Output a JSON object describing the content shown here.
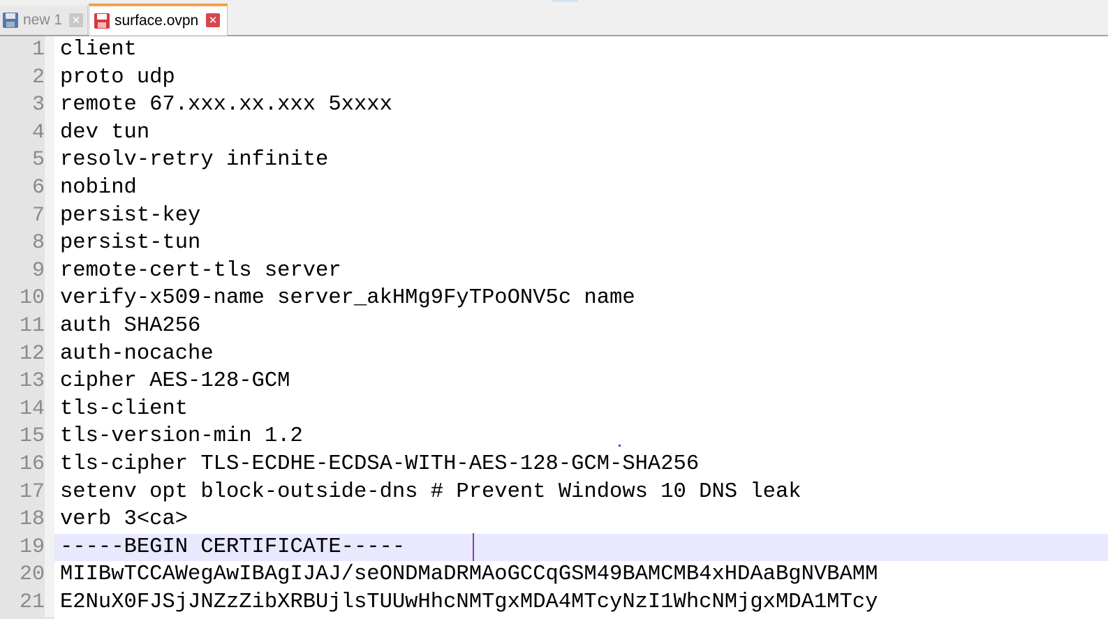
{
  "tabs": [
    {
      "label": "new 1",
      "active": false,
      "icon": "disk-icon",
      "icon_color": "#5577aa"
    },
    {
      "label": "surface.ovpn",
      "active": true,
      "icon": "disk-icon",
      "icon_color": "#d9363e"
    }
  ],
  "editor": {
    "current_line": 19,
    "lines": [
      {
        "num": "1",
        "text": "client"
      },
      {
        "num": "2",
        "text": "proto udp"
      },
      {
        "num": "3",
        "text": "remote 67.xxx.xx.xxx 5xxxx"
      },
      {
        "num": "4",
        "text": "dev tun"
      },
      {
        "num": "5",
        "text": "resolv-retry infinite"
      },
      {
        "num": "6",
        "text": "nobind"
      },
      {
        "num": "7",
        "text": "persist-key"
      },
      {
        "num": "8",
        "text": "persist-tun"
      },
      {
        "num": "9",
        "text": "remote-cert-tls server"
      },
      {
        "num": "10",
        "text": "verify-x509-name server_akHMg9FyTPoONV5c name"
      },
      {
        "num": "11",
        "text": "auth SHA256"
      },
      {
        "num": "12",
        "text": "auth-nocache"
      },
      {
        "num": "13",
        "text": "cipher AES-128-GCM"
      },
      {
        "num": "14",
        "text": "tls-client"
      },
      {
        "num": "15",
        "text": "tls-version-min 1.2"
      },
      {
        "num": "16",
        "text": "tls-cipher TLS-ECDHE-ECDSA-WITH-AES-128-GCM-SHA256"
      },
      {
        "num": "17",
        "text": "setenv opt block-outside-dns # Prevent Windows 10 DNS leak"
      },
      {
        "num": "18",
        "text": "verb 3<ca>"
      },
      {
        "num": "19",
        "text": "-----BEGIN CERTIFICATE-----"
      },
      {
        "num": "20",
        "text": "MIIBwTCCAWegAwIBAgIJAJ/seONDMaDRMAoGCCqGSM49BAMCMB4xHDAaBgNVBAMM"
      },
      {
        "num": "21",
        "text": "E2NuX0FJSjJNZzZibXRBUjlsTUUwHhcNMTgxMDA4MTcyNzI1WhcNMjgxMDA1MTcy"
      }
    ]
  }
}
